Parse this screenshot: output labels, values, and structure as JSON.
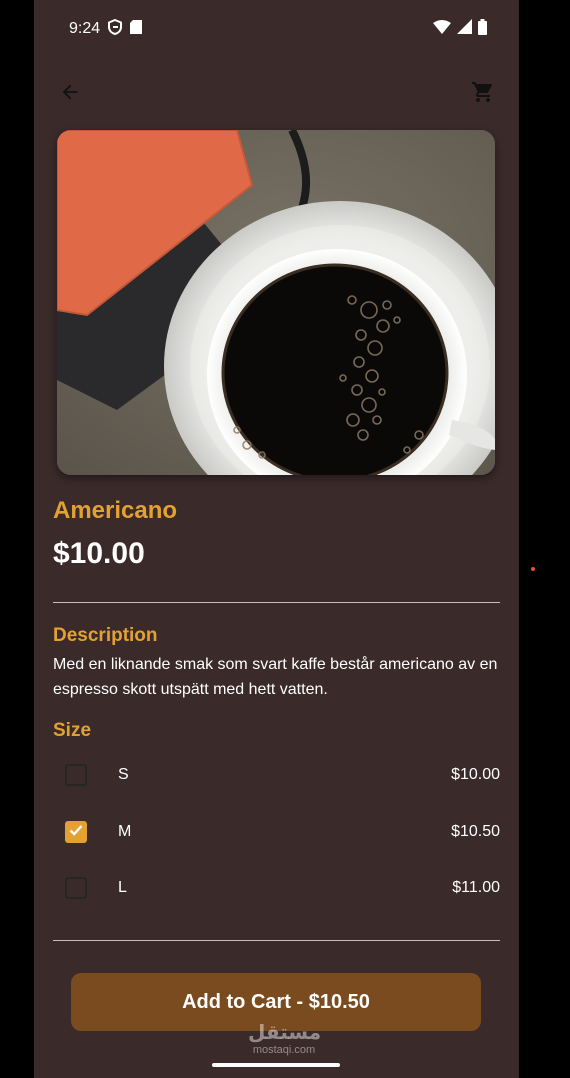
{
  "status_bar": {
    "time": "9:24",
    "icons": [
      "shield-icon",
      "sd-card-icon",
      "wifi-icon",
      "signal-icon",
      "battery-icon"
    ]
  },
  "app_bar": {
    "back_icon": "arrow-back-icon",
    "cart_icon": "shopping-cart-icon"
  },
  "product": {
    "name": "Americano",
    "price": "$10.00",
    "description_title": "Description",
    "description": "Med en liknande smak som svart kaffe består americano av en espresso skott utspätt med hett vatten.",
    "size_title": "Size",
    "sizes": [
      {
        "label": "S",
        "price": "$10.00",
        "checked": false
      },
      {
        "label": "M",
        "price": "$10.50",
        "checked": true
      },
      {
        "label": "L",
        "price": "$11.00",
        "checked": false
      }
    ]
  },
  "cta": {
    "label": "Add to Cart - $10.50"
  },
  "watermark": {
    "arabic": "مستقل",
    "latin": "mostaqi.com"
  },
  "colors": {
    "background": "#3a2a2a",
    "accent": "#e3a133",
    "button": "#7a4b1e",
    "text": "#ffffff"
  }
}
